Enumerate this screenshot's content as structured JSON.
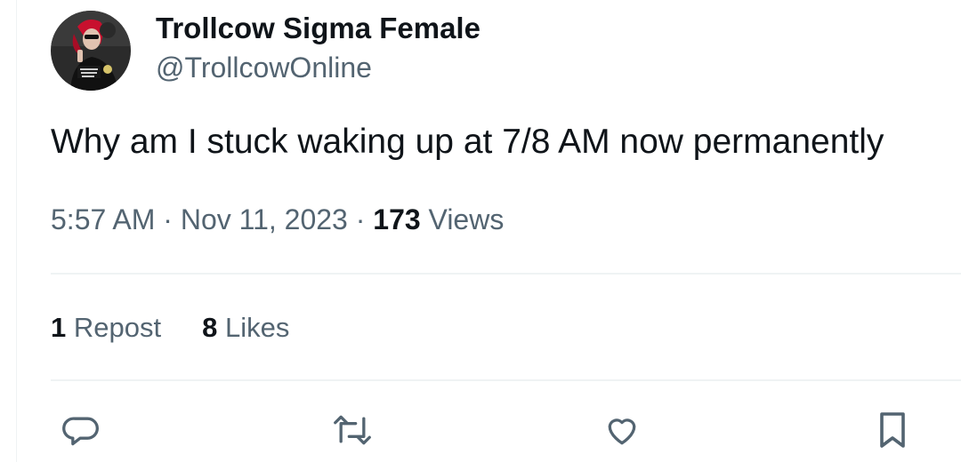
{
  "user": {
    "display_name": "Trollcow Sigma Female",
    "handle": "@TrollcowOnline",
    "avatar_icon": "profile-photo"
  },
  "tweet": {
    "text": "Why am I stuck waking up at 7/8 AM now permanently",
    "time": "5:57 AM",
    "separator": "·",
    "date": "Nov 11, 2023",
    "views_count": "173",
    "views_label": "Views"
  },
  "stats": {
    "reposts_count": "1",
    "reposts_label": "Repost",
    "likes_count": "8",
    "likes_label": "Likes"
  },
  "actions": {
    "reply_icon": "reply-icon",
    "repost_icon": "repost-icon",
    "like_icon": "heart-icon",
    "bookmark_icon": "bookmark-icon"
  },
  "colors": {
    "primary_text": "#0f1419",
    "secondary_text": "#536471",
    "divider": "#eff3f4",
    "avatar_accent": "#c8102e"
  }
}
